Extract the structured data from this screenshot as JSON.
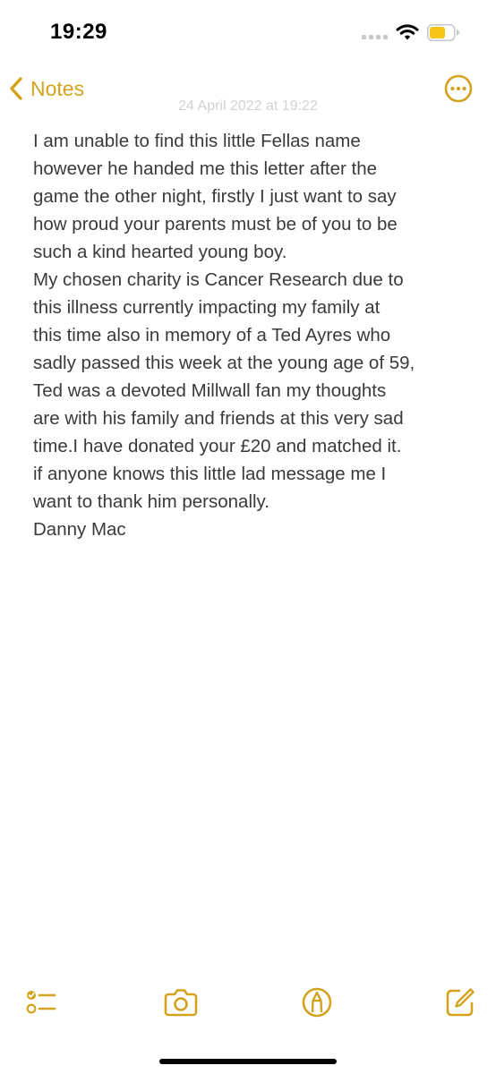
{
  "status_bar": {
    "time": "19:29",
    "icons": [
      "cellular-signal-icon",
      "wifi-icon",
      "battery-icon"
    ]
  },
  "nav": {
    "back_label": "Notes",
    "date": "24 April 2022 at 19:22",
    "more_icon": "ellipsis-circle-icon"
  },
  "note": {
    "lines": [
      "I am unable to find this little Fellas name",
      "however he handed me this letter after the",
      "game the other night, firstly I just want to say",
      "how proud your parents must be of you to be",
      "such a kind hearted young boy.",
      "My chosen charity is Cancer Research due to",
      "this illness currently impacting my family at",
      "this time also in memory of a Ted Ayres who",
      "sadly passed this week at the young age of 59,",
      "Ted was a devoted Millwall fan my thoughts",
      "are with his family and friends at this very sad",
      "time.I have donated your £20 and matched it.",
      "if anyone knows this little lad message me I",
      "want to thank him personally.",
      "Danny Mac"
    ]
  },
  "toolbar": {
    "icons": [
      "checklist-icon",
      "camera-icon",
      "markup-icon",
      "compose-icon"
    ]
  },
  "colors": {
    "accent": "#d4a31e",
    "text": "#3a3a3c",
    "date_text": "#d2d2d6",
    "background": "#ffffff"
  }
}
